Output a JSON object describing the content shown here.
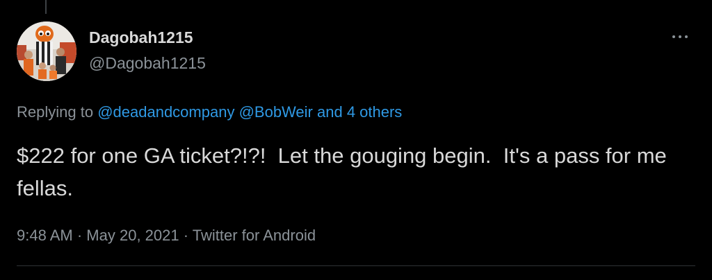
{
  "tweet": {
    "author": {
      "display_name": "Dagobah1215",
      "handle": "@Dagobah1215",
      "avatar_icon": "profile-photo"
    },
    "more_icon": "more-horizontal-icon",
    "reply_context": {
      "prefix": "Replying to",
      "mention_1": "@deadandcompany",
      "mention_2": "@BobWeir",
      "others": "and 4 others"
    },
    "text": "$222 for one GA ticket?!?!  Let the gouging begin.  It's a pass for me fellas.",
    "meta": {
      "time": "9:48 AM",
      "separator": "·",
      "date": "May 20, 2021",
      "source": "Twitter for Android"
    }
  },
  "colors": {
    "background": "#000000",
    "text": "#d9d9d9",
    "muted": "#8b9298",
    "link": "#2f99e4",
    "divider": "#2f3336"
  }
}
